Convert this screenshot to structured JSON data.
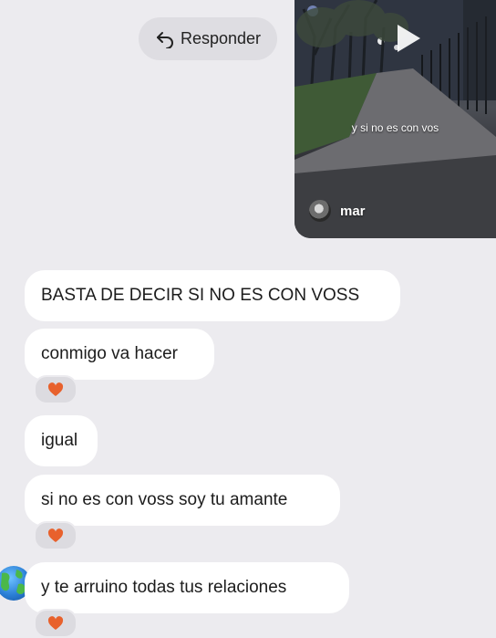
{
  "reply": {
    "label": "Responder",
    "icon": "reply-arrow-icon"
  },
  "story": {
    "caption": "y si no es con vos",
    "author": "mar",
    "play_icon": "play-icon"
  },
  "messages": [
    {
      "text": "BASTA DE DECIR SI NO ES CON VOSS"
    },
    {
      "text": "conmigo va hacer",
      "reaction": "heart"
    },
    {
      "text": "igual"
    },
    {
      "text": "si no es con voss soy tu amante",
      "reaction": "heart"
    },
    {
      "text": "y te arruino todas tus relaciones",
      "reaction": "heart"
    }
  ],
  "colors": {
    "background": "#ecebef",
    "bubble": "#ffffff",
    "heart": "#e8612c"
  }
}
